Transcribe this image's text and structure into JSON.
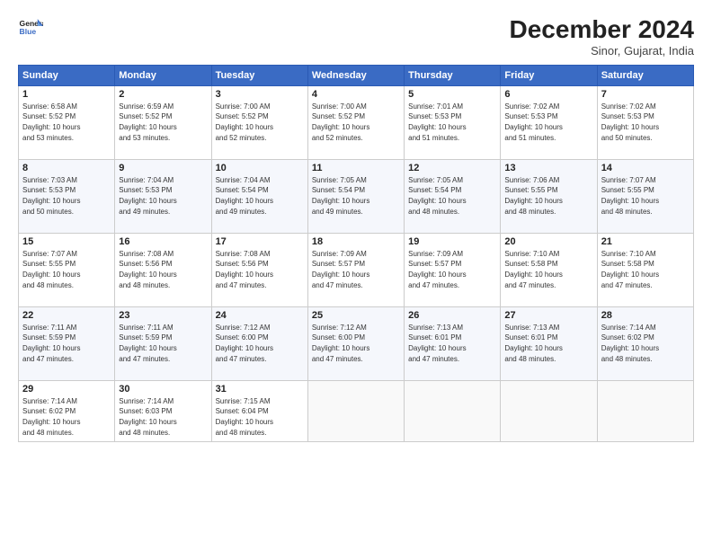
{
  "logo": {
    "line1": "General",
    "line2": "Blue"
  },
  "title": "December 2024",
  "location": "Sinor, Gujarat, India",
  "days_header": [
    "Sunday",
    "Monday",
    "Tuesday",
    "Wednesday",
    "Thursday",
    "Friday",
    "Saturday"
  ],
  "weeks": [
    [
      {
        "day": "1",
        "content": "Sunrise: 6:58 AM\nSunset: 5:52 PM\nDaylight: 10 hours\nand 53 minutes."
      },
      {
        "day": "2",
        "content": "Sunrise: 6:59 AM\nSunset: 5:52 PM\nDaylight: 10 hours\nand 53 minutes."
      },
      {
        "day": "3",
        "content": "Sunrise: 7:00 AM\nSunset: 5:52 PM\nDaylight: 10 hours\nand 52 minutes."
      },
      {
        "day": "4",
        "content": "Sunrise: 7:00 AM\nSunset: 5:52 PM\nDaylight: 10 hours\nand 52 minutes."
      },
      {
        "day": "5",
        "content": "Sunrise: 7:01 AM\nSunset: 5:53 PM\nDaylight: 10 hours\nand 51 minutes."
      },
      {
        "day": "6",
        "content": "Sunrise: 7:02 AM\nSunset: 5:53 PM\nDaylight: 10 hours\nand 51 minutes."
      },
      {
        "day": "7",
        "content": "Sunrise: 7:02 AM\nSunset: 5:53 PM\nDaylight: 10 hours\nand 50 minutes."
      }
    ],
    [
      {
        "day": "8",
        "content": "Sunrise: 7:03 AM\nSunset: 5:53 PM\nDaylight: 10 hours\nand 50 minutes."
      },
      {
        "day": "9",
        "content": "Sunrise: 7:04 AM\nSunset: 5:53 PM\nDaylight: 10 hours\nand 49 minutes."
      },
      {
        "day": "10",
        "content": "Sunrise: 7:04 AM\nSunset: 5:54 PM\nDaylight: 10 hours\nand 49 minutes."
      },
      {
        "day": "11",
        "content": "Sunrise: 7:05 AM\nSunset: 5:54 PM\nDaylight: 10 hours\nand 49 minutes."
      },
      {
        "day": "12",
        "content": "Sunrise: 7:05 AM\nSunset: 5:54 PM\nDaylight: 10 hours\nand 48 minutes."
      },
      {
        "day": "13",
        "content": "Sunrise: 7:06 AM\nSunset: 5:55 PM\nDaylight: 10 hours\nand 48 minutes."
      },
      {
        "day": "14",
        "content": "Sunrise: 7:07 AM\nSunset: 5:55 PM\nDaylight: 10 hours\nand 48 minutes."
      }
    ],
    [
      {
        "day": "15",
        "content": "Sunrise: 7:07 AM\nSunset: 5:55 PM\nDaylight: 10 hours\nand 48 minutes."
      },
      {
        "day": "16",
        "content": "Sunrise: 7:08 AM\nSunset: 5:56 PM\nDaylight: 10 hours\nand 48 minutes."
      },
      {
        "day": "17",
        "content": "Sunrise: 7:08 AM\nSunset: 5:56 PM\nDaylight: 10 hours\nand 47 minutes."
      },
      {
        "day": "18",
        "content": "Sunrise: 7:09 AM\nSunset: 5:57 PM\nDaylight: 10 hours\nand 47 minutes."
      },
      {
        "day": "19",
        "content": "Sunrise: 7:09 AM\nSunset: 5:57 PM\nDaylight: 10 hours\nand 47 minutes."
      },
      {
        "day": "20",
        "content": "Sunrise: 7:10 AM\nSunset: 5:58 PM\nDaylight: 10 hours\nand 47 minutes."
      },
      {
        "day": "21",
        "content": "Sunrise: 7:10 AM\nSunset: 5:58 PM\nDaylight: 10 hours\nand 47 minutes."
      }
    ],
    [
      {
        "day": "22",
        "content": "Sunrise: 7:11 AM\nSunset: 5:59 PM\nDaylight: 10 hours\nand 47 minutes."
      },
      {
        "day": "23",
        "content": "Sunrise: 7:11 AM\nSunset: 5:59 PM\nDaylight: 10 hours\nand 47 minutes."
      },
      {
        "day": "24",
        "content": "Sunrise: 7:12 AM\nSunset: 6:00 PM\nDaylight: 10 hours\nand 47 minutes."
      },
      {
        "day": "25",
        "content": "Sunrise: 7:12 AM\nSunset: 6:00 PM\nDaylight: 10 hours\nand 47 minutes."
      },
      {
        "day": "26",
        "content": "Sunrise: 7:13 AM\nSunset: 6:01 PM\nDaylight: 10 hours\nand 47 minutes."
      },
      {
        "day": "27",
        "content": "Sunrise: 7:13 AM\nSunset: 6:01 PM\nDaylight: 10 hours\nand 48 minutes."
      },
      {
        "day": "28",
        "content": "Sunrise: 7:14 AM\nSunset: 6:02 PM\nDaylight: 10 hours\nand 48 minutes."
      }
    ],
    [
      {
        "day": "29",
        "content": "Sunrise: 7:14 AM\nSunset: 6:02 PM\nDaylight: 10 hours\nand 48 minutes."
      },
      {
        "day": "30",
        "content": "Sunrise: 7:14 AM\nSunset: 6:03 PM\nDaylight: 10 hours\nand 48 minutes."
      },
      {
        "day": "31",
        "content": "Sunrise: 7:15 AM\nSunset: 6:04 PM\nDaylight: 10 hours\nand 48 minutes."
      },
      {
        "day": "",
        "content": ""
      },
      {
        "day": "",
        "content": ""
      },
      {
        "day": "",
        "content": ""
      },
      {
        "day": "",
        "content": ""
      }
    ]
  ]
}
